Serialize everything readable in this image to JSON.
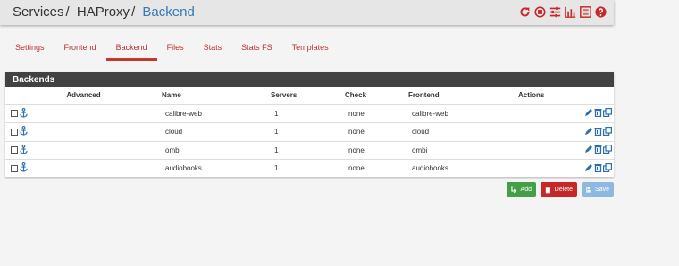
{
  "breadcrumb": {
    "items": [
      "Services",
      "HAProxy",
      "Backend"
    ],
    "separator": "/"
  },
  "header_icons": [
    "reload-icon",
    "stop-icon",
    "sliders-icon",
    "chart-icon",
    "list-icon",
    "help-icon"
  ],
  "tabs": [
    {
      "label": "Settings",
      "active": false
    },
    {
      "label": "Frontend",
      "active": false
    },
    {
      "label": "Backend",
      "active": true
    },
    {
      "label": "Files",
      "active": false
    },
    {
      "label": "Stats",
      "active": false
    },
    {
      "label": "Stats FS",
      "active": false
    },
    {
      "label": "Templates",
      "active": false
    }
  ],
  "panel": {
    "title": "Backends",
    "columns": [
      "Advanced",
      "Name",
      "Servers",
      "Check",
      "Frontend",
      "Actions"
    ],
    "rows": [
      {
        "name": "calibre-web",
        "servers": "1",
        "check": "none",
        "frontend": "calibre-web"
      },
      {
        "name": "cloud",
        "servers": "1",
        "check": "none",
        "frontend": "cloud"
      },
      {
        "name": "ombi",
        "servers": "1",
        "check": "none",
        "frontend": "ombi"
      },
      {
        "name": "audiobooks",
        "servers": "1",
        "check": "none",
        "frontend": "audiobooks"
      }
    ]
  },
  "buttons": {
    "add": "Add",
    "delete": "Delete",
    "save": "Save"
  },
  "colors": {
    "accent_red": "#c0392b",
    "link_blue": "#337ab7",
    "add_green": "#43a047",
    "delete_red": "#c62828",
    "save_blue": "#8fb8e0"
  }
}
